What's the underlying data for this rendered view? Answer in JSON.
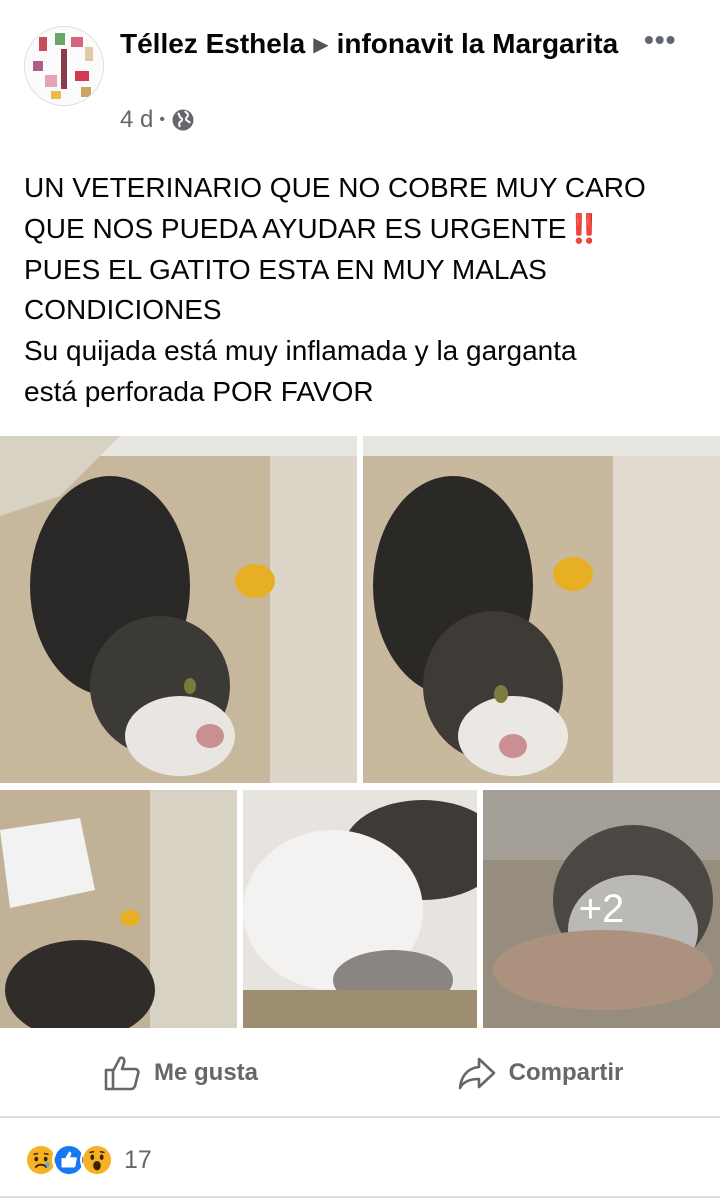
{
  "post": {
    "author_name": "Téllez Esthela",
    "group_name": "infonavit la Margarita",
    "time": "4 d",
    "privacy_icon": "globe-icon",
    "more_icon": "more-icon",
    "text_lines": [
      "UN VETERINARIO QUE NO COBRE MUY CARO",
      "QUE NOS PUEDA AYUDAR ES URGENTE",
      "PUES EL GATITO ESTA EN MUY MALAS",
      "CONDICIONES",
      "Su quijada está muy inflamada y la garganta",
      "está perforada POR FAVOR"
    ],
    "emoji_bang": "‼️",
    "more_photos_label": "+2"
  },
  "actions": {
    "like_label": "Me gusta",
    "share_label": "Compartir"
  },
  "reactions": {
    "icons": [
      "sad-reaction-icon",
      "like-reaction-icon",
      "wow-reaction-icon"
    ],
    "count": "17"
  },
  "colors": {
    "text": "#050505",
    "secondary": "#65676b",
    "like_blue": "#1877f2",
    "reaction_yellow": "#f7b125"
  }
}
